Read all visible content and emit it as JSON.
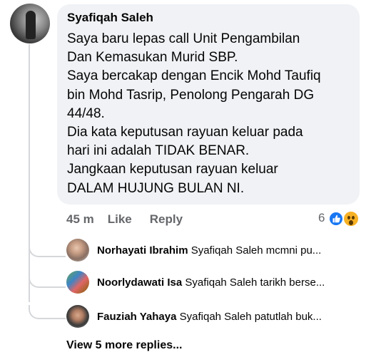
{
  "comment": {
    "author": "Syafiqah Saleh",
    "lines": [
      "Saya baru lepas call Unit Pengambilan",
      "Dan Kemasukan Murid SBP.",
      "Saya bercakap dengan Encik Mohd Taufiq",
      "bin Mohd Tasrip, Penolong Pengarah DG",
      "44/48.",
      "Dia kata keputusan rayuan keluar pada",
      "hari ini adalah TIDAK BENAR.",
      "Jangkaan keputusan rayuan keluar",
      "DALAM HUJUNG BULAN NI."
    ],
    "timestamp": "45 m",
    "like_label": "Like",
    "reply_label": "Reply",
    "reaction_count": "6",
    "reactions": [
      "like-icon",
      "wow-icon"
    ]
  },
  "replies": [
    {
      "name": "Norhayati Ibrahim",
      "snippet": "Syafiqah Saleh mcmni pu..."
    },
    {
      "name": "Noorlydawati Isa",
      "snippet": "Syafiqah Saleh tarikh berse..."
    },
    {
      "name": "Fauziah Yahaya",
      "snippet": "Syafiqah Saleh patutlah buk..."
    }
  ],
  "view_more": "View 5 more replies...",
  "colors": {
    "bubble": "#f0f2f5",
    "muted_text": "#65676b",
    "like_blue": "#1877f2",
    "wow_yellow": "#f7b125"
  }
}
